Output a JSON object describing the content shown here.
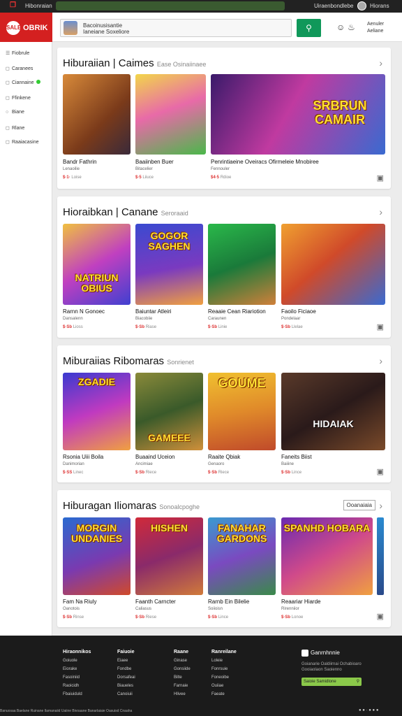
{
  "topbar": {
    "logo": "❒",
    "title": "Hibonraian",
    "right": "Uiraenbondlebe",
    "user": "Hiorans"
  },
  "header": {
    "brand": "OBRIK",
    "brand_badge": "SALE",
    "search_text": "Bacoinusisantie\nIaneiane Soxeliore",
    "search_icon": "search-icon",
    "profile_icon": "user-icon",
    "notif_icon": "bell-icon",
    "right_line1": "Aenuler",
    "right_line2": "Aeliane"
  },
  "sidebar": {
    "items": [
      {
        "icon": "☰",
        "label": "Fiobrule"
      },
      {
        "icon": "◻",
        "label": "Caranees"
      },
      {
        "icon": "◻",
        "label": "Ciannaine"
      },
      {
        "icon": "◻",
        "label": "Ffinkene"
      },
      {
        "icon": "○",
        "label": "Biane"
      },
      {
        "icon": "◻",
        "label": "Rlane"
      },
      {
        "icon": "◻",
        "label": "Raaiacasine"
      }
    ]
  },
  "sections": [
    {
      "title": "Hiburaiian",
      "title2": "Caimes",
      "sub": "Ease Osinaiinaee",
      "cards": [
        {
          "name": "Bandr Fathrin",
          "cat": "Lenaoilie",
          "price_a": "$·1·",
          "price_b": "Loise",
          "art": ""
        },
        {
          "name": "Baaiinben Buer",
          "cat": "Bitacelier",
          "price_a": "$·5",
          "price_b": "Liiuce",
          "art": ""
        },
        {
          "name": "Penrintiaeine Oveiracs Ofirmeleie Mnobiree",
          "cat": "Fennouler",
          "price_a": "$4·5",
          "price_b": "Rdioe",
          "art": "SRBRUN CAMAIR"
        }
      ]
    },
    {
      "title": "Hioraibkan",
      "title2": "Canane",
      "sub": "Seroraaid",
      "cards": [
        {
          "name": "Rarnn N Gonoec",
          "cat": "Dansalenn",
          "price_a": "$·Sb",
          "price_b": "Lioss",
          "art": "NATRIUN OBIUS"
        },
        {
          "name": "Baiuntar Atleiri",
          "cat": "Biacobiie",
          "price_a": "$·Sb",
          "price_b": "Riase",
          "art": "GOGOR SAGHEN"
        },
        {
          "name": "Reaaie Cean Riariotion",
          "cat": "Caraunen",
          "price_a": "$·Sb",
          "price_b": "Linie",
          "art": ""
        },
        {
          "name": "Faoilo Ficiaoe",
          "cat": "Pondelaar",
          "price_a": "$·Sb",
          "price_b": "Llelae",
          "art": ""
        }
      ]
    },
    {
      "title": "Miburaiias",
      "title2": "Ribomaras",
      "sub": "Sonrienet",
      "cards": [
        {
          "name": "Rsonia Uiii Boila",
          "cat": "Danimorian",
          "price_a": "$·SS",
          "price_b": "Linec",
          "art": "ZGADIE"
        },
        {
          "name": "Buaaind Uceion",
          "cat": "Ancimiae",
          "price_a": "$·Sb",
          "price_b": "Riece",
          "art": "GAMEEE"
        },
        {
          "name": "Raaite Qbiak",
          "cat": "Genaoro",
          "price_a": "$·Sb",
          "price_b": "Riece",
          "art": "GOUME"
        },
        {
          "name": "Faneits Biist",
          "cat": "Baiiine",
          "price_a": "$·Sb",
          "price_b": "Lince",
          "art": "HIDAIAK"
        }
      ]
    },
    {
      "title": "Hiburagan",
      "title2": "Iliomaras",
      "sub": "Sonoalcpoghe",
      "viewall": "Ooanaiaia",
      "cards": [
        {
          "name": "Fam Na Riuly",
          "cat": "Oanotois",
          "price_a": "$·Sb",
          "price_b": "Rinse",
          "art": "MORGIN UNDANIES"
        },
        {
          "name": "Faanth Carncter",
          "cat": "Caliasus",
          "price_a": "$·Sb",
          "price_b": "Riese",
          "art": "HISHEN"
        },
        {
          "name": "Rarnb Ein Bilelie",
          "cat": "Soiioisn",
          "price_a": "$·Sb",
          "price_b": "Lince",
          "art": "FANAHAR GARDONS"
        },
        {
          "name": "Reaariar Hiarde",
          "cat": "Rirenniior",
          "price_a": "$·Sb",
          "price_b": "Lonoe",
          "art": "SPANHD HOBARA"
        }
      ]
    }
  ],
  "footer": {
    "cols": [
      {
        "h": "Hiraonnikos",
        "items": [
          "Goiuole",
          "Eiorake",
          "Fasoiniid",
          "Raoicidh",
          "Fbaiuiduld"
        ]
      },
      {
        "h": "Faiuoie",
        "items": [
          "Eiaee",
          "Fondbe",
          "Dorsafeai",
          "Biaueles",
          "Canoiuii"
        ]
      },
      {
        "h": "Raane",
        "items": [
          "Ginase",
          "Gonsiide",
          "Bilte",
          "Farnaie",
          "Hlivee"
        ]
      },
      {
        "h": "Ranreilane",
        "items": [
          "Loleie",
          "Fonrsuie",
          "Foneoibe",
          "Ouiiae",
          "Faeate"
        ]
      }
    ],
    "brand": "Ganrnhnnie",
    "desc": "Goianarie Oaldiirnai Ochabioaro\nGooiaolaon Saoienno",
    "subscribe": "Saioie Samidlone",
    "copy": "Banuosaa Baelane Ruinane Ilamanaiid Uaiine Bivoaane Banarlaiaie Oasuisd Cnaaha",
    "social": "● ● · ● ● ●"
  },
  "colors": {
    "brand": "#d42020",
    "accent": "#10985a",
    "price": "#d33333"
  }
}
